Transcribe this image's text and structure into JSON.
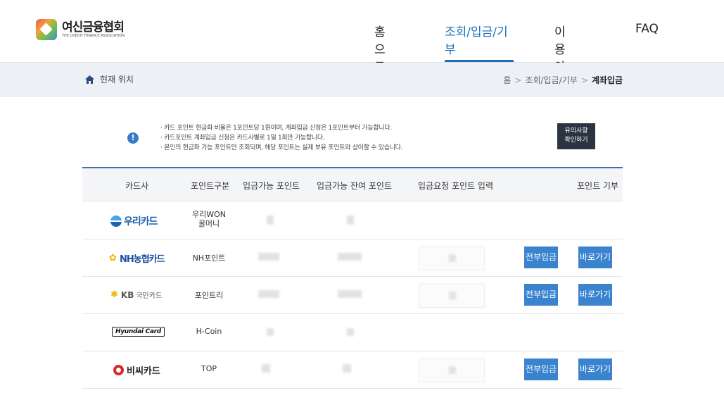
{
  "header": {
    "logo_title": "여신금융협회",
    "logo_sub": "THE CREDIT FINANCE ASSOCIATION",
    "nav": [
      {
        "label": "홈으로"
      },
      {
        "label": "조회/입금/기부",
        "active": true
      },
      {
        "label": "이용안내"
      },
      {
        "label": "FAQ"
      }
    ]
  },
  "breadcrumb": {
    "location_label": "현재 위치",
    "path": [
      "홈",
      "조회/입금/기부",
      "계좌입금"
    ],
    "separator": ">"
  },
  "notice": {
    "lines": [
      "카드 포인트 현금화 비율은 1포인트당 1원이며, 계좌입금 신청은 1포인트부터 가능합니다.",
      "카드포인트 계좌입금 신청은 카드사별로 1일 1회만 가능합니다.",
      "본인의 현금화 가능 포인트만 조회되며, 해당 포인트는 실제 보유 포인트와 상이할 수 있습니다."
    ],
    "caution_button_line1": "유의사항",
    "caution_button_line2": "확인하기"
  },
  "table": {
    "headers": {
      "card_company": "카드사",
      "point_type": "포인트구분",
      "available": "입금가능 포인트",
      "remaining": "입금가능 잔여 포인트",
      "request_input": "입금요청 포인트 입력",
      "donate": "포인트 기부"
    },
    "rows": [
      {
        "card": "우리카드",
        "point_type_line1": "우리WON",
        "point_type_line2": "꿀머니"
      },
      {
        "card": "NH농협카드",
        "point_type": "NH포인트",
        "deposit_all": "전부입금",
        "go": "바로가기"
      },
      {
        "card": "KB국민카드",
        "card_brand": "KB",
        "card_name": "국민카드",
        "point_type": "포인트리",
        "deposit_all": "전부입금",
        "go": "바로가기"
      },
      {
        "card": "Hyundai Card",
        "point_type": "H-Coin"
      },
      {
        "card": "비씨카드",
        "point_type": "TOP",
        "deposit_all": "전부입금",
        "go": "바로가기"
      }
    ]
  },
  "colors": {
    "accent": "#1e6fb8",
    "button": "#3a84cf",
    "crumb_bg": "#edf1f6",
    "dark_button": "#2b3442"
  },
  "icons": {
    "home": "home-icon",
    "info": "info-icon"
  }
}
